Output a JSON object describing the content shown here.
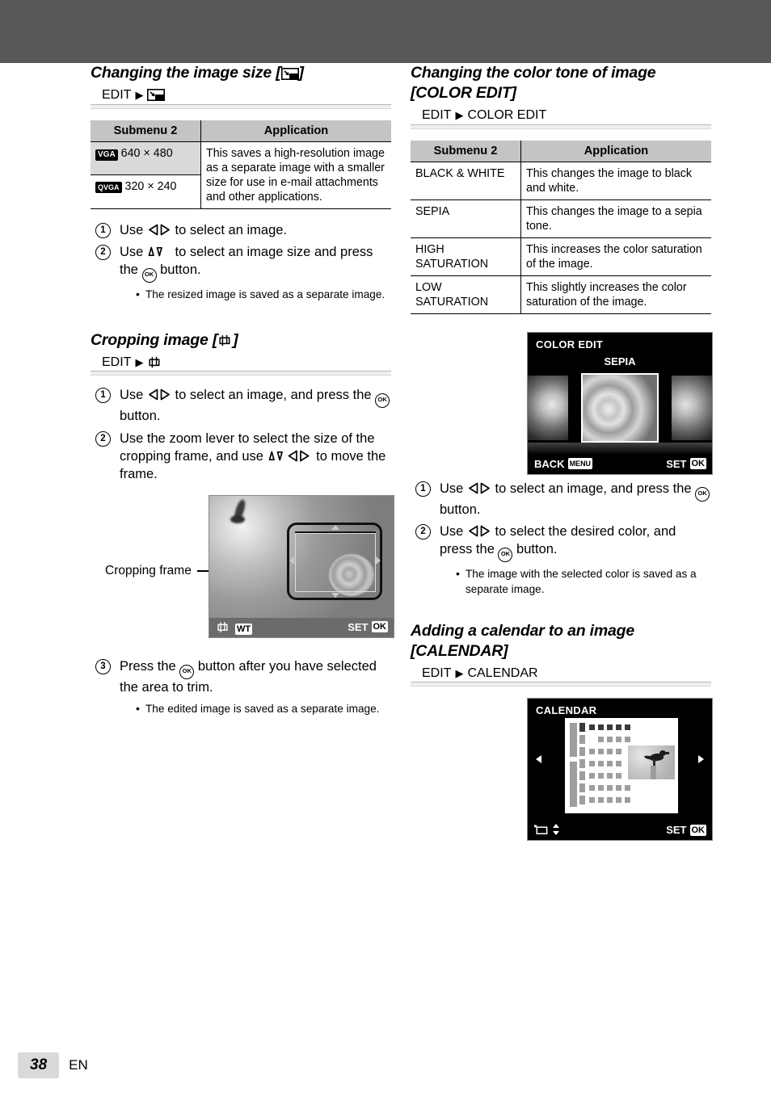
{
  "page": {
    "number": "38",
    "language": "EN"
  },
  "left_column": {
    "section1": {
      "heading": "Changing the image size [",
      "heading_suffix": "]",
      "heading_icon": "resize-icon",
      "path_label": "EDIT",
      "path_icon": "resize-icon",
      "table": {
        "headers": [
          "Submenu 2",
          "Application"
        ],
        "rows": [
          {
            "badge": "VGA",
            "label": "640 × 480",
            "highlighted": true
          },
          {
            "badge": "QVGA",
            "label": "320 × 240",
            "highlighted": false
          }
        ],
        "application": "This saves a high-resolution image as a separate image with a smaller size for use in e-mail attachments and other applications."
      },
      "steps": [
        {
          "num": "1",
          "text_a": "Use ",
          "icon": "left-right-arrows-icon",
          "text_b": " to select an image."
        },
        {
          "num": "2",
          "text_a": "Use ",
          "icon": "up-down-arrows-icon",
          "text_b": " to select an image size and press the ",
          "icon2": "ok-button-icon",
          "text_c": " button."
        }
      ],
      "note": "The resized image is saved as a separate image."
    },
    "section2": {
      "heading": "Cropping image [",
      "heading_suffix": "]",
      "heading_icon": "crop-icon",
      "path_label": "EDIT",
      "path_icon": "crop-icon",
      "steps": [
        {
          "num": "1",
          "text_a": "Use ",
          "icon": "left-right-arrows-icon",
          "text_b": " to select an image, and press the ",
          "icon2": "ok-button-icon",
          "text_c": " button."
        },
        {
          "num": "2",
          "text_a": "Use the zoom lever to select the size of the cropping frame, and use ",
          "icon": "up-down-left-right-arrows-icon",
          "text_b": " to move the frame."
        },
        {
          "num": "3",
          "text_a": "Press the ",
          "icon2": "ok-button-icon",
          "text_c": " button after you have selected the area to trim."
        }
      ],
      "note": "The edited image is saved as a separate image.",
      "figure": {
        "caption": "Cropping frame",
        "bottom_bar": {
          "left_icon": "crop-icon",
          "zoom_badge": "WT",
          "set_label": "SET",
          "set_badge": "OK"
        }
      }
    }
  },
  "right_column": {
    "section1": {
      "heading_line1": "Changing the color tone of image",
      "heading_line2": "[COLOR EDIT]",
      "path_label": "EDIT",
      "path_target": "COLOR EDIT",
      "table": {
        "headers": [
          "Submenu 2",
          "Application"
        ],
        "rows": [
          {
            "name": "BLACK & WHITE",
            "desc": "This changes the image to black and white."
          },
          {
            "name": "SEPIA",
            "desc": "This changes the image to a sepia tone."
          },
          {
            "name": "HIGH SATURATION",
            "desc": "This increases the color saturation of the image."
          },
          {
            "name": "LOW SATURATION",
            "desc": "This slightly increases the color saturation of the image."
          }
        ]
      },
      "screen": {
        "title": "COLOR EDIT",
        "selected_label": "SEPIA",
        "back_label": "BACK",
        "back_badge": "MENU",
        "set_label": "SET",
        "set_badge": "OK"
      },
      "steps": [
        {
          "num": "1",
          "text_a": "Use ",
          "icon": "left-right-arrows-icon",
          "text_b": " to select an image, and press the ",
          "icon2": "ok-button-icon",
          "text_c": " button."
        },
        {
          "num": "2",
          "text_a": "Use ",
          "icon": "left-right-arrows-icon",
          "text_b": " to select the desired color, and press the ",
          "icon2": "ok-button-icon",
          "text_c": " button."
        }
      ],
      "note": "The image with the selected color is saved as a separate image."
    },
    "section2": {
      "heading_line1": "Adding a calendar to an image",
      "heading_line2": "[CALENDAR]",
      "path_label": "EDIT",
      "path_target": "CALENDAR",
      "screen": {
        "title": "CALENDAR",
        "left_icon": "calendar-layout-icon",
        "updown_icon": "up-down-arrows-icon",
        "set_label": "SET",
        "set_badge": "OK"
      }
    }
  },
  "colors": {
    "topbar": "#585858",
    "table_header": "#c4c4c4",
    "row_highlight": "#d9d9d9",
    "screen_bg": "#000000",
    "page_badge": "#d9d9d9"
  }
}
